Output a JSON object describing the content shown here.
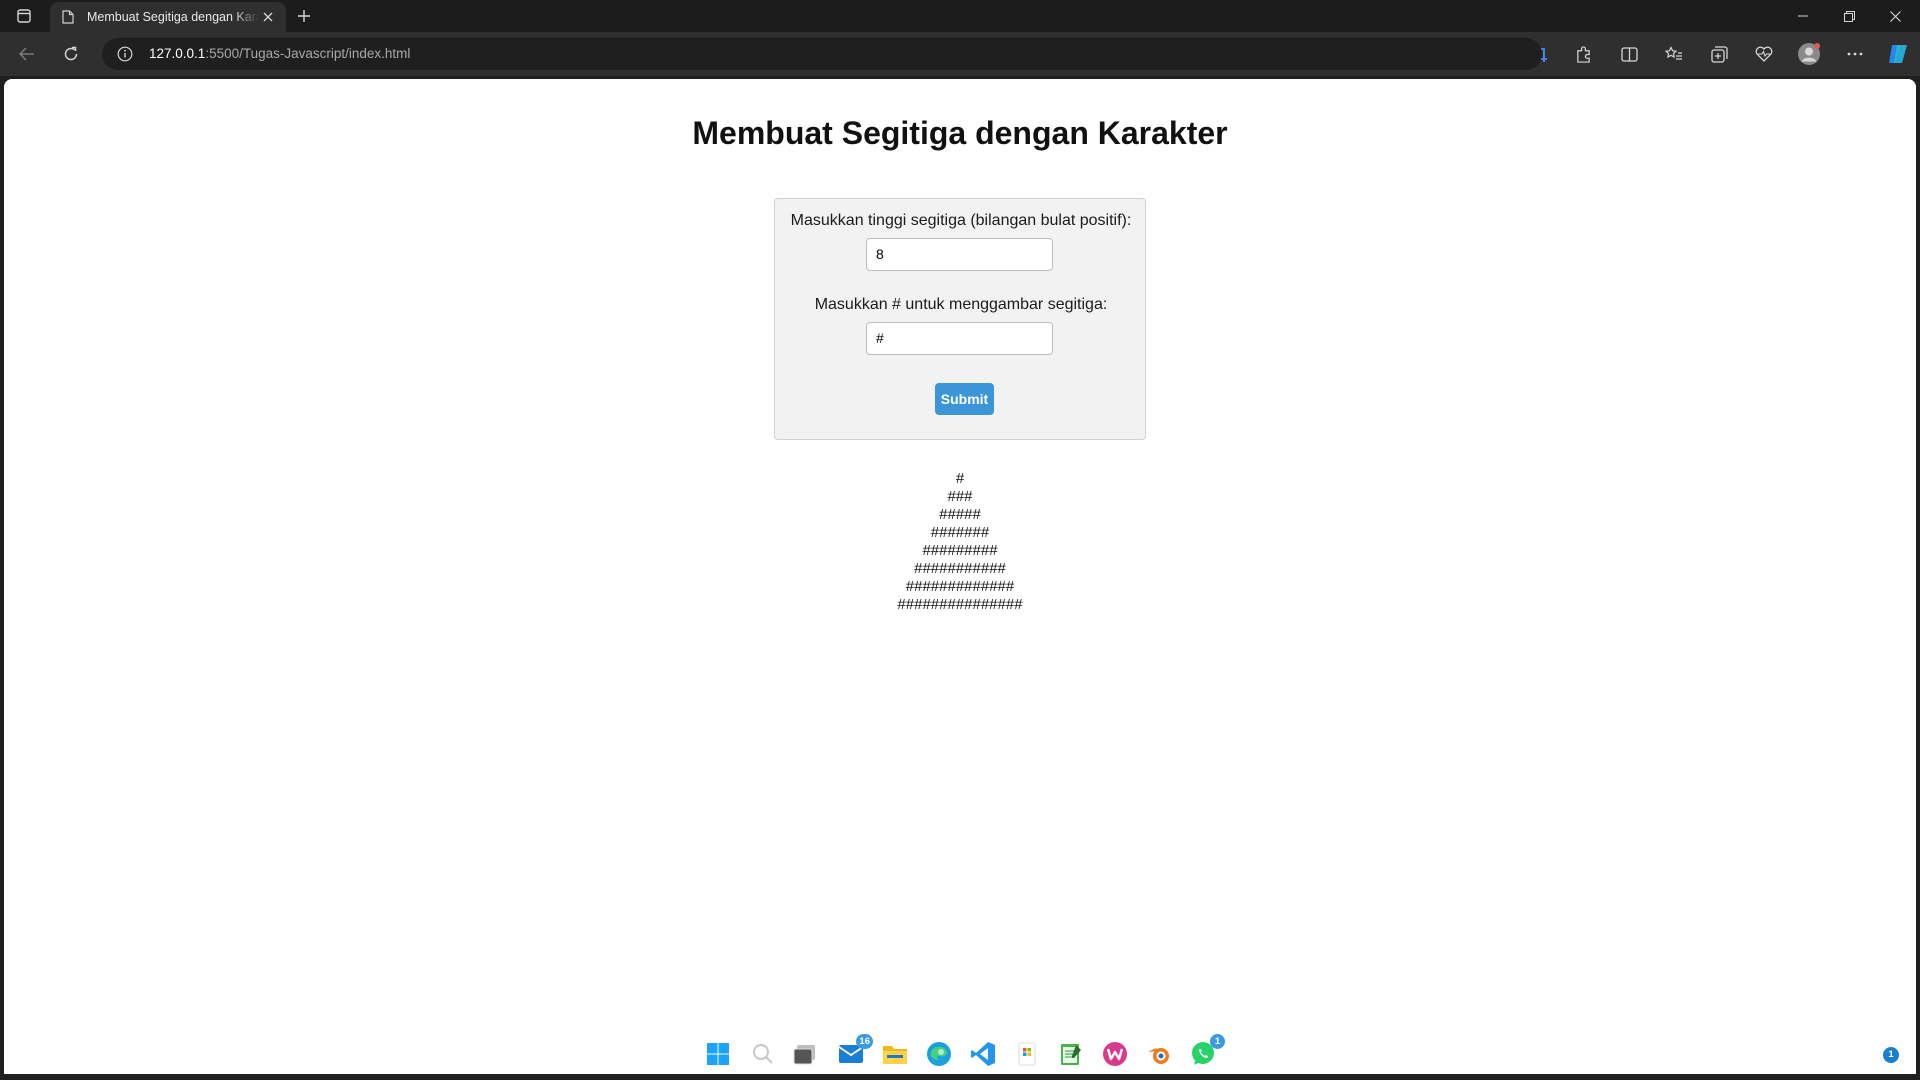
{
  "browser": {
    "tab": {
      "title": "Membuat Segitiga dengan Karakter",
      "favicon": "page-icon"
    },
    "address": {
      "host": "127.0.0.1",
      "path": ":5500/Tugas-Javascript/index.html"
    },
    "colors": {
      "chrome": "#1c1c1c",
      "toolbar": "#2f2f2f",
      "accent": "#4a8df8"
    }
  },
  "page": {
    "title": "Membuat Segitiga dengan Karakter",
    "form": {
      "height_label": "Masukkan tinggi segitiga (bilangan bulat positif):",
      "height_value": "8",
      "char_label": "Masukkan # untuk menggambar segitiga:",
      "char_value": "#",
      "submit_label": "Submit",
      "submit_color": "#3b95d9"
    },
    "triangle_rows": [
      "#",
      "###",
      "#####",
      "#######",
      "#########",
      "###########",
      "#############",
      "###############"
    ]
  },
  "taskbar": {
    "icons": [
      "windows-start-icon",
      "search-icon",
      "task-view-icon",
      "mail-icon",
      "file-explorer-icon",
      "edge-icon",
      "vscode-icon",
      "store-icon",
      "notepad-icon",
      "app-w-icon",
      "blender-icon",
      "whatsapp-icon"
    ],
    "mail_badge": "16",
    "whatsapp_badge": "1",
    "notification_badge": "1"
  }
}
